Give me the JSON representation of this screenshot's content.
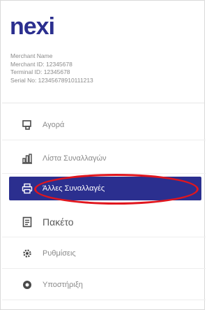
{
  "brand": {
    "logo_text": "nexi",
    "color": "#2b2f8f"
  },
  "terminal_info": {
    "merchant_name": "Merchant Name",
    "merchant_id": "Merchant ID: 12345678",
    "terminal_id": "Terminal ID: 12345678",
    "serial_no": "Serial No: 12345678910111213"
  },
  "menu": {
    "items": [
      {
        "label": "Αγορά",
        "icon": "cart-icon"
      },
      {
        "label": "Λίστα Συναλλαγών",
        "icon": "bar-chart-icon"
      },
      {
        "label": "Άλλες Συναλλαγές",
        "icon": "printer-icon",
        "active": true
      },
      {
        "label": "Πακέτο",
        "icon": "document-icon"
      },
      {
        "label": "Ρυθμίσεις",
        "icon": "gear-icon"
      },
      {
        "label": "Υποστήριξη",
        "icon": "support-icon"
      }
    ]
  },
  "colors": {
    "active_bg": "#2b2f8f",
    "annotation": "#e0161e"
  }
}
